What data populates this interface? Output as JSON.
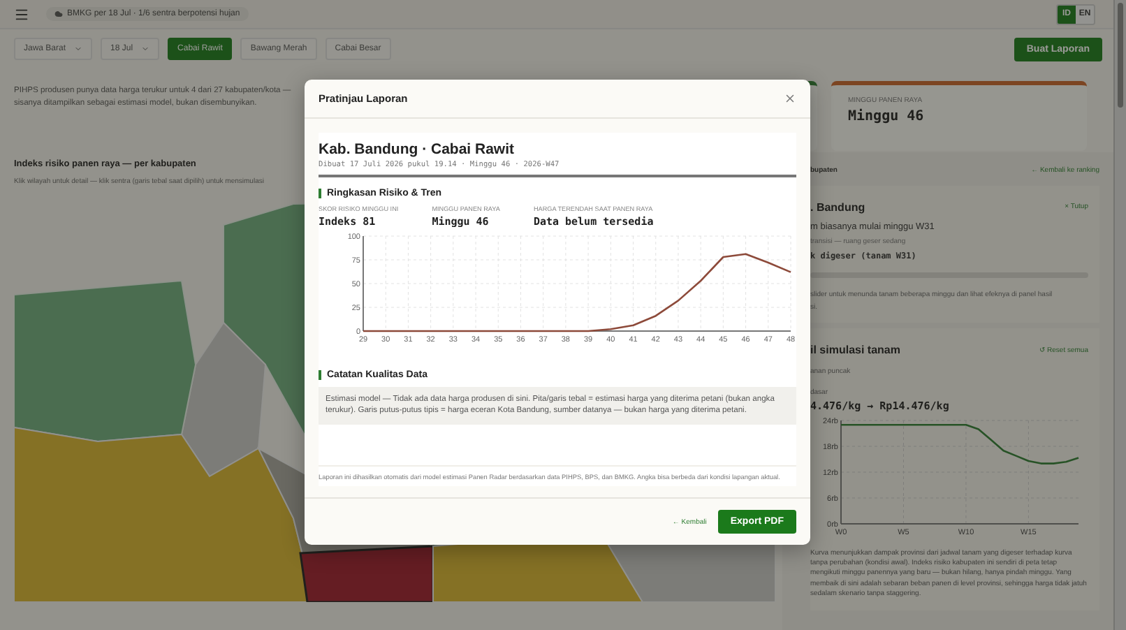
{
  "top_bar": {
    "notice": "BMKG per 18 Jul · 1/6 sentra berpotensi hujan",
    "languages": [
      {
        "label": "ID",
        "selected": true
      },
      {
        "label": "EN",
        "selected": false
      }
    ]
  },
  "filters": {
    "selects": [
      "Jawa Barat",
      "18 Jul"
    ],
    "commodities": [
      {
        "label": "Cabai Rawit",
        "selected": true
      },
      {
        "label": "Bawang Merah",
        "selected": false
      },
      {
        "label": "Cabai Besar",
        "selected": false
      }
    ],
    "create_button": "Buat Laporan"
  },
  "coverage_note": "PIHPS produsen punya data harga terukur untuk 4 dari 27 kabupaten/kota — sisanya ditampilkan sebagai estimasi model, bukan disembunyikan.",
  "map_section": {
    "title": "Indeks risiko panen raya — per kabupaten",
    "subtitle": "Klik wilayah untuk detail — klik sentra (garis tebal saat dipilih) untuk mensimulasi"
  },
  "stat_card": {
    "label": "MINGGU PANEN RAYA",
    "value": "Minggu 46"
  },
  "detail_panel": {
    "header": "bupaten",
    "back_link": "← Kembali ke ranking",
    "title": ". Bandung",
    "close": "× Tutup",
    "lines": [
      {
        "kind": "body",
        "text": "m biasanya mulai minggu W31"
      },
      {
        "kind": "muted",
        "text": "transisi — ruang geser sedang"
      },
      {
        "kind": "mono",
        "text": "k digeser (tanam W31)"
      }
    ],
    "hint": [
      "slider untuk menunda tanam beberapa minggu dan lihat efeknya di panel hasil",
      "si."
    ]
  },
  "simulation": {
    "title": "il simulasi tanam",
    "reset": "↺ Reset semua",
    "caption": "anan puncak",
    "price_label": "dasar",
    "price": "4.476/kg → Rp14.476/kg",
    "chart_data": {
      "type": "line",
      "grid": true,
      "categories": [
        "W0",
        null,
        null,
        null,
        null,
        "W5",
        null,
        null,
        null,
        null,
        "W10",
        null,
        null,
        null,
        null,
        "W15",
        null,
        null,
        null,
        null
      ],
      "series": [
        {
          "color": "#2e7d32",
          "values": [
            23,
            23,
            23,
            23,
            23,
            23,
            23,
            23,
            23,
            23,
            23,
            22,
            19.5,
            17,
            15.8,
            14.6,
            14,
            14,
            14.4,
            15.3
          ]
        }
      ],
      "ylim": [
        0,
        24
      ],
      "yticks": [
        {
          "value": 0,
          "label": "0rb"
        },
        {
          "value": 6,
          "label": "6rb"
        },
        {
          "value": 12,
          "label": "12rb"
        },
        {
          "value": 18,
          "label": "18rb"
        },
        {
          "value": 24,
          "label": "24rb"
        }
      ]
    },
    "note": "Kurva menunjukkan dampak provinsi dari jadwal tanam yang digeser terhadap kurva tanpa perubahan (kondisi awal). Indeks risiko kabupaten ini sendiri di peta tetap mengikuti minggu panennya yang baru — bukan hilang, hanya pindah minggu. Yang membaik di sini adalah sebaran beban panen di level provinsi, sehingga harga tidak jatuh sedalam skenario tanpa staggering."
  },
  "modal": {
    "title": "Pratinjau Laporan",
    "report": {
      "title": "Kab. Bandung · Cabai Rawit",
      "meta": "Dibuat 17 Juli 2026 pukul 19.14 · Minggu 46 · 2026-W47",
      "summary": {
        "title": "Ringkasan Risiko & Tren",
        "stats": [
          {
            "label": "SKOR RISIKO MINGGU INI",
            "value": "Indeks 81"
          },
          {
            "label": "MINGGU PANEN RAYA",
            "value": "Minggu 46"
          },
          {
            "label": "HARGA TERENDAH SAAT PANEN RAYA",
            "value": "Data belum tersedia"
          }
        ],
        "chart_data": {
          "type": "line",
          "grid": true,
          "x": [
            29,
            30,
            31,
            32,
            33,
            34,
            35,
            36,
            37,
            38,
            39,
            40,
            41,
            42,
            43,
            44,
            45,
            46,
            47,
            48
          ],
          "series": [
            {
              "color": "#8d4a3a",
              "values": [
                0,
                0,
                0,
                0,
                0,
                0,
                0,
                0,
                0,
                0,
                0,
                2,
                6,
                16,
                32,
                53,
                78,
                81,
                72,
                62
              ]
            }
          ],
          "xlim": [
            29,
            48
          ],
          "ylim": [
            0,
            100
          ],
          "xticks": [
            29,
            30,
            31,
            32,
            33,
            34,
            35,
            36,
            37,
            38,
            39,
            40,
            41,
            42,
            43,
            44,
            45,
            46,
            47,
            48
          ],
          "yticks": [
            0,
            25,
            50,
            75,
            100
          ]
        }
      },
      "quality": {
        "title": "Catatan Kualitas Data",
        "text": "Estimasi model — Tidak ada data harga produsen di sini. Pita/garis tebal = estimasi harga yang diterima petani (bukan angka terukur). Garis putus-putus tipis = harga eceran Kota Bandung, sumber datanya — bukan harga yang diterima petani."
      },
      "footer": "Laporan ini dihasilkan otomatis dari model estimasi Panen Radar berdasarkan data PIHPS, BPS, dan BMKG. Angka bisa berbeda dari kondisi lapangan aktual."
    },
    "back": "← Kembali",
    "export": "Export PDF"
  }
}
